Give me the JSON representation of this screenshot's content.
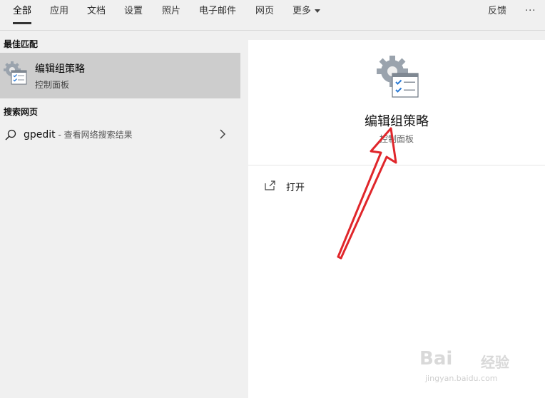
{
  "tabs": {
    "all": "全部",
    "apps": "应用",
    "documents": "文档",
    "settings": "设置",
    "photos": "照片",
    "email": "电子邮件",
    "web": "网页",
    "more": "更多",
    "feedback": "反馈",
    "ellipsis": "···"
  },
  "left": {
    "best_match_heading": "最佳匹配",
    "best_match": {
      "title": "编辑组策略",
      "subtitle": "控制面板",
      "icon": "group-policy-icon"
    },
    "search_web_heading": "搜索网页",
    "web_result": {
      "query": "gpedit",
      "description": " - 查看网络搜索结果",
      "icon": "search-icon"
    }
  },
  "right": {
    "title": "编辑组策略",
    "subtitle": "控制面板",
    "actions": {
      "open": "打开"
    }
  },
  "watermark": {
    "brand_latin": "Bai",
    "brand_cjk": "经验",
    "url": "jingyan.baidu.com"
  },
  "colors": {
    "selected_bg": "#cdcdcd",
    "arrow": "#e0262b"
  }
}
